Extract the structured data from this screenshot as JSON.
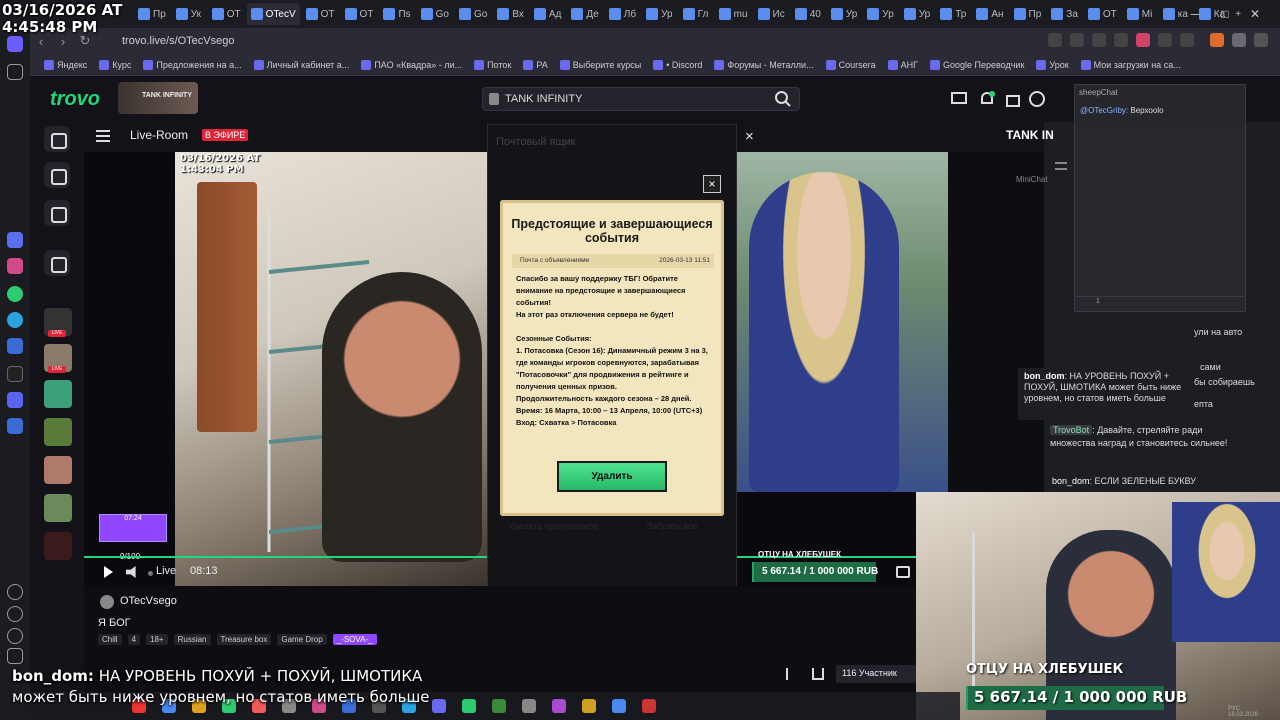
{
  "overlay_timestamp": {
    "line1": "03/16/2026 AT",
    "line2": "4:45:48 PM"
  },
  "browser": {
    "tabs": [
      {
        "label": "Пр"
      },
      {
        "label": "Ук"
      },
      {
        "label": "ОТ"
      },
      {
        "label": "OTecV",
        "active": true
      },
      {
        "label": "ОТ"
      },
      {
        "label": "ОТ"
      },
      {
        "label": "Пs"
      },
      {
        "label": "Go"
      },
      {
        "label": "Go"
      },
      {
        "label": "Вх"
      },
      {
        "label": "Ад"
      },
      {
        "label": "Де"
      },
      {
        "label": "Лб"
      },
      {
        "label": "Ур"
      },
      {
        "label": "Гл"
      },
      {
        "label": "mu"
      },
      {
        "label": "Ис"
      },
      {
        "label": "40"
      },
      {
        "label": "Ур"
      },
      {
        "label": "Ур"
      },
      {
        "label": "Ур"
      },
      {
        "label": "Тр"
      },
      {
        "label": "Ан"
      },
      {
        "label": "Пр"
      },
      {
        "label": "За"
      },
      {
        "label": "ОТ"
      },
      {
        "label": "Мі"
      },
      {
        "label": "ка"
      },
      {
        "label": "Ка"
      }
    ],
    "new_tab": "+",
    "url": "trovo.live/s/OTecVsego",
    "bookmarks": [
      "Яндекс",
      "Курс",
      "Предложения на а...",
      "Личный кабинет а...",
      "ПАО «Квадра» - ли...",
      "Поток",
      "РА",
      "Выберите курсы",
      "• Discord",
      "Форумы - Металли...",
      "Coursera",
      "АНГ",
      "Google Переводчик",
      "Урок",
      "Мои загрузки на са..."
    ]
  },
  "trovo": {
    "logo": "trovo",
    "game_badge": "TANK INFINITY",
    "search_value": "TANK INFINITY",
    "live_room": "Live-Room",
    "on_air": "В ЭФИРЕ",
    "chat_header": "TANK IN"
  },
  "video": {
    "overlay_time": {
      "line1": "03/16/2026 AT",
      "line2": "1:43:04 PM"
    },
    "mini_counter_top": "07:24",
    "mini_counter": "9/100",
    "live_label": "Live",
    "time": "08:13",
    "goal_label": "ОТЦУ НА ХЛЕБУШЕК",
    "goal_value": "5 667.14 / 1 000 000 RUB",
    "goal_progress": 0.00567
  },
  "modal": {
    "back_title": "Почтовый ящик",
    "title": "Предстоящие и завершающиеся события",
    "row_label": "Почта с объявлениями",
    "row_date": "2026-03-13 11:51",
    "body": [
      "Спасибо за вашу поддержку ТБГ! Обратите внимание на предстоящие и завершающиеся события!",
      "На этот раз отключения сервера не будет!",
      "",
      "Сезонные События:",
      "1. Потасовка (Сезон 16): Динамичный режим 3 на 3, где команды игроков соревнуются, зарабатывая \"Потасовочки\" для продвижения в рейтинге и получения ценных призов.",
      "Продолжительность каждого сезона – 28 дней.",
      "Время: 16 Марта, 10:00 – 13 Апреля, 10:00 (UTC+3)",
      "Вход: Схватка > Потасовка"
    ],
    "delete_button": "Удалить",
    "bottom_left": "Удалить прочитанное",
    "bottom_right": "Забрать все",
    "close": "×"
  },
  "streamer": {
    "name": "OTecVsego",
    "title": "Я БОГ",
    "tags": [
      "Chill",
      "4",
      "18+",
      "Russian",
      "Treasure box",
      "Game Drop",
      "_-SOVA-_"
    ],
    "participants": "116 Участник"
  },
  "caption": {
    "user": "bon_dom:",
    "line1": "НА УРОВЕНЬ ПОХУЙ + ПОХУЙ, ШМОТИКА",
    "line2": "может быть ниже уровнем, но статов иметь больше"
  },
  "chat": {
    "minichat_label": "MiniChat",
    "sheepchat_title": "sheepChat",
    "sheepchat_msg_user": "@OTecGriby:",
    "sheepchat_msg_text": "Верхоolo",
    "sheepchat_count": "1",
    "right_lines": [
      "ули на авто",
      "сами",
      "бы собираешь",
      "епта"
    ],
    "bon_user": "bon_dom",
    "bon_text": "НА УРОВЕНЬ ПОХУЙ + ПОХУЙ, ШМОТИКА может быть ниже уровнем, но статов иметь больше",
    "bot_name": "TrovoBot",
    "bot_text": "Давайте, стреляйте ради множества наград и становитесь сильнее!",
    "bon2_text": "ЕСЛИ ЗЕЛЕНЫЕ БУКВУ"
  },
  "webcam": {
    "goal_label": "ОТЦУ НА ХЛЕБУШЕК",
    "goal_value": "5 667.14 / 1 000 000 RUB",
    "goal_progress": 0.00567
  },
  "taskbar": {
    "lang": "РУС",
    "date": "16.03.2026"
  },
  "colors": {
    "accent": "#24d67a",
    "live": "#e0243a",
    "purple": "#9146ff"
  }
}
